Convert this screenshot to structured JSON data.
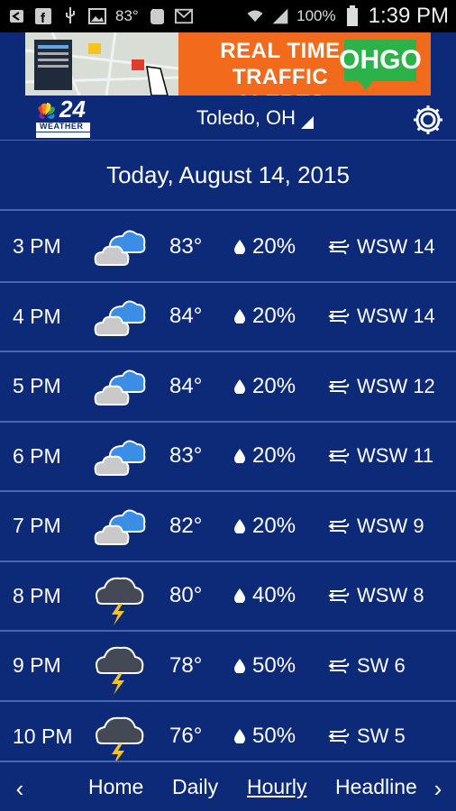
{
  "status_bar": {
    "battery_text": "100%",
    "temp_text": "83°",
    "time": "1:39 PM",
    "icons": [
      "back-icon",
      "facebook-icon",
      "usb-icon",
      "image-icon",
      "temperature-text",
      "evernote-icon",
      "mail-icon",
      "wifi-icon",
      "signal-icon",
      "battery-icon"
    ]
  },
  "ad": {
    "headline_line1": "REAL TIME",
    "headline_line2": "TRAFFIC ALERTS",
    "brand": "OHGO"
  },
  "header": {
    "logo_number": "24",
    "logo_text": "WEATHER",
    "location": "Toledo, OH"
  },
  "date_title": "Today, August 14, 2015",
  "hours": [
    {
      "time": "3 PM",
      "icon": "partly-cloudy-icon",
      "temp": "83°",
      "precip": "20%",
      "wind": "WSW 14"
    },
    {
      "time": "4 PM",
      "icon": "partly-cloudy-icon",
      "temp": "84°",
      "precip": "20%",
      "wind": "WSW 14"
    },
    {
      "time": "5 PM",
      "icon": "partly-cloudy-icon",
      "temp": "84°",
      "precip": "20%",
      "wind": "WSW 12"
    },
    {
      "time": "6 PM",
      "icon": "partly-cloudy-icon",
      "temp": "83°",
      "precip": "20%",
      "wind": "WSW 11"
    },
    {
      "time": "7 PM",
      "icon": "partly-cloudy-icon",
      "temp": "82°",
      "precip": "20%",
      "wind": "WSW 9"
    },
    {
      "time": "8 PM",
      "icon": "thunderstorm-icon",
      "temp": "80°",
      "precip": "40%",
      "wind": "WSW 8"
    },
    {
      "time": "9 PM",
      "icon": "thunderstorm-icon",
      "temp": "78°",
      "precip": "50%",
      "wind": "SW 6"
    },
    {
      "time": "10 PM",
      "icon": "thunderstorm-icon",
      "temp": "76°",
      "precip": "50%",
      "wind": "SW 5"
    }
  ],
  "nav": {
    "prev_arrow": "‹",
    "next_arrow": "›",
    "items": [
      "Home",
      "Daily",
      "Hourly",
      "Headline"
    ],
    "active": "Hourly"
  },
  "colors": {
    "background": "#0d2a78",
    "divider": "#4a65b4",
    "ad_orange": "#f26a1c",
    "brand_green": "#2bb34a",
    "cloud_blue": "#3a8ee6",
    "cloud_gray": "#c9c9c9",
    "storm_cloud": "#444a55",
    "bolt_yellow": "#f7c21c"
  }
}
